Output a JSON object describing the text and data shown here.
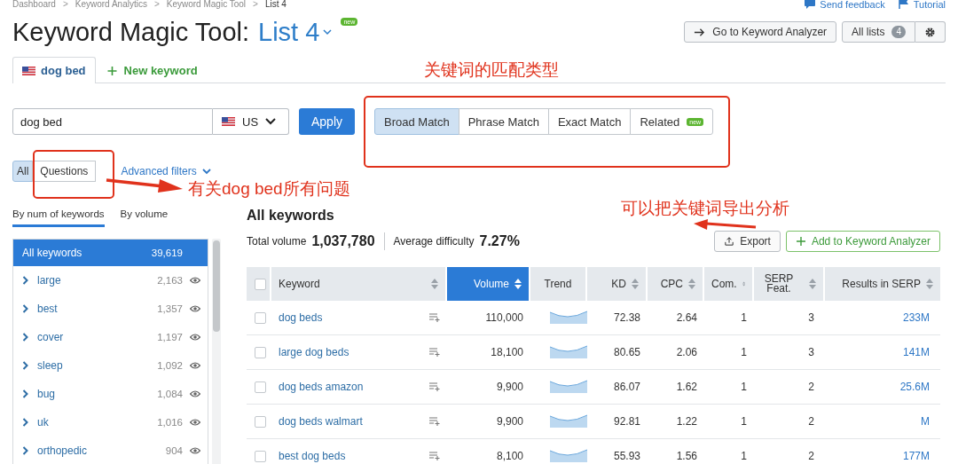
{
  "breadcrumbs": [
    "Dashboard",
    "Keyword Analytics",
    "Keyword Magic Tool",
    "List 4"
  ],
  "breadcrumb_separator": ">",
  "header_links": [
    {
      "label": "Send feedback",
      "kind": "feedback"
    },
    {
      "label": "Tutorial",
      "kind": "tutorial"
    }
  ],
  "title": "Keyword Magic Tool:",
  "list_name": "List 4",
  "list_badge": "new",
  "toolbar": {
    "go_to": "Go to Keyword Analyzer",
    "all_lists": "All lists",
    "all_lists_count": "4"
  },
  "keyword_tabs": [
    {
      "label": "dog bed",
      "kind": "keyword",
      "selected": true
    },
    {
      "label": "New keyword",
      "kind": "new",
      "selected": false
    }
  ],
  "search": {
    "value": "dog bed",
    "country": "US",
    "apply": "Apply"
  },
  "match_types": [
    {
      "label": "Broad Match",
      "selected": true
    },
    {
      "label": "Phrase Match",
      "selected": false
    },
    {
      "label": "Exact Match",
      "selected": false
    },
    {
      "label": "Related",
      "selected": false,
      "badge": "new"
    }
  ],
  "filters": [
    {
      "label": "All",
      "selected": true
    },
    {
      "label": "Questions",
      "selected": false
    }
  ],
  "advanced_filters": "Advanced filters",
  "sort_tabs": [
    {
      "label": "By num of keywords",
      "selected": true
    },
    {
      "label": "By volume",
      "selected": false
    }
  ],
  "groups": [
    {
      "label": "All keywords",
      "count": "39,619",
      "kind": "all",
      "selected": true
    },
    {
      "label": "large",
      "count": "2,163",
      "kind": "group",
      "selected": false
    },
    {
      "label": "best",
      "count": "1,357",
      "kind": "group",
      "selected": false
    },
    {
      "label": "cover",
      "count": "1,197",
      "kind": "group",
      "selected": false
    },
    {
      "label": "sleep",
      "count": "1,092",
      "kind": "group",
      "selected": false
    },
    {
      "label": "bug",
      "count": "1,084",
      "kind": "group",
      "selected": false
    },
    {
      "label": "uk",
      "count": "1,016",
      "kind": "group",
      "selected": false
    },
    {
      "label": "orthopedic",
      "count": "904",
      "kind": "group",
      "selected": false
    }
  ],
  "heading": "All keywords",
  "summary": {
    "total_label": "Total volume",
    "total_value": "1,037,780",
    "avg_label": "Average difficulty",
    "avg_value": "7.27%"
  },
  "actions": {
    "export": "Export",
    "add": "Add to Keyword Analyzer"
  },
  "table": {
    "select_all_checked": false,
    "columns": [
      {
        "label": "Keyword",
        "sortable": true,
        "selected": false
      },
      {
        "label": "Volume",
        "sortable": true,
        "selected": true
      },
      {
        "label": "Trend",
        "sortable": false,
        "selected": false
      },
      {
        "label": "KD",
        "sortable": true,
        "selected": false
      },
      {
        "label": "CPC",
        "sortable": true,
        "selected": false
      },
      {
        "label": "Com.",
        "sortable": true,
        "selected": false
      },
      {
        "label": "SERP Feat.",
        "sortable": true,
        "selected": false
      },
      {
        "label": "Results in SERP",
        "sortable": true,
        "selected": false
      }
    ],
    "rows": [
      {
        "checked": false,
        "keyword": "dog beds",
        "volume": "110,000",
        "kd": "72.38",
        "cpc": "2.64",
        "com": "1",
        "serp": "3",
        "results": "233M"
      },
      {
        "checked": false,
        "keyword": "large dog beds",
        "volume": "18,100",
        "kd": "80.65",
        "cpc": "2.06",
        "com": "1",
        "serp": "3",
        "results": "141M"
      },
      {
        "checked": false,
        "keyword": "dog beds amazon",
        "volume": "9,900",
        "kd": "86.07",
        "cpc": "1.62",
        "com": "1",
        "serp": "2",
        "results": "25.6M"
      },
      {
        "checked": false,
        "keyword": "dog beds walmart",
        "volume": "9,900",
        "kd": "92.81",
        "cpc": "1.22",
        "com": "1",
        "serp": "2",
        "results": "M"
      },
      {
        "checked": false,
        "keyword": "best dog beds",
        "volume": "8,100",
        "kd": "55.93",
        "cpc": "1.56",
        "com": "1",
        "serp": "2",
        "results": "177M"
      }
    ]
  },
  "annotations": {
    "match_note": "关键词的匹配类型",
    "questions_note": "有关dog bed所有问题",
    "export_note": "可以把关键词导出分析"
  }
}
